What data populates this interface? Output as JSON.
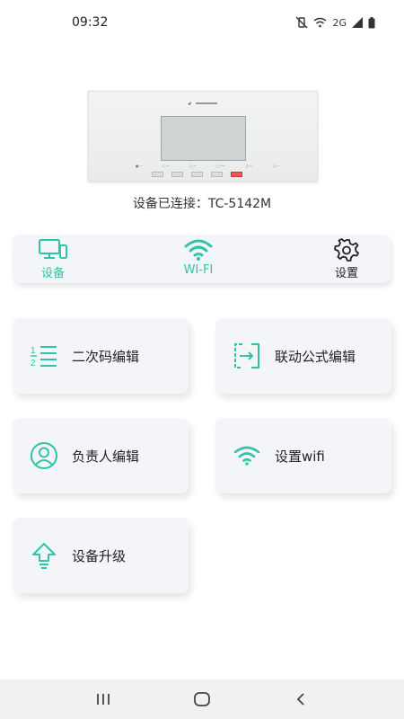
{
  "status_bar": {
    "time": "09:32",
    "network_label": "2G"
  },
  "device": {
    "logo_text": "",
    "status_text": "设备已连接：TC-5142M"
  },
  "tabs": [
    {
      "label": "设备",
      "icon": "monitor-phone-icon",
      "active": true
    },
    {
      "label": "WI-FI",
      "icon": "wifi-icon",
      "active": true
    },
    {
      "label": "设置",
      "icon": "gear-icon",
      "active": false
    }
  ],
  "cards": [
    {
      "label": "二次码编辑",
      "icon": "numbered-list-icon"
    },
    {
      "label": "联动公式编辑",
      "icon": "transfer-icon"
    },
    {
      "label": "负责人编辑",
      "icon": "user-circle-icon"
    },
    {
      "label": "设置wifi",
      "icon": "wifi-icon"
    },
    {
      "label": "设备升级",
      "icon": "upgrade-arrow-icon"
    }
  ],
  "colors": {
    "accent": "#2ec4a6",
    "card_bg": "#f3f5f9"
  }
}
